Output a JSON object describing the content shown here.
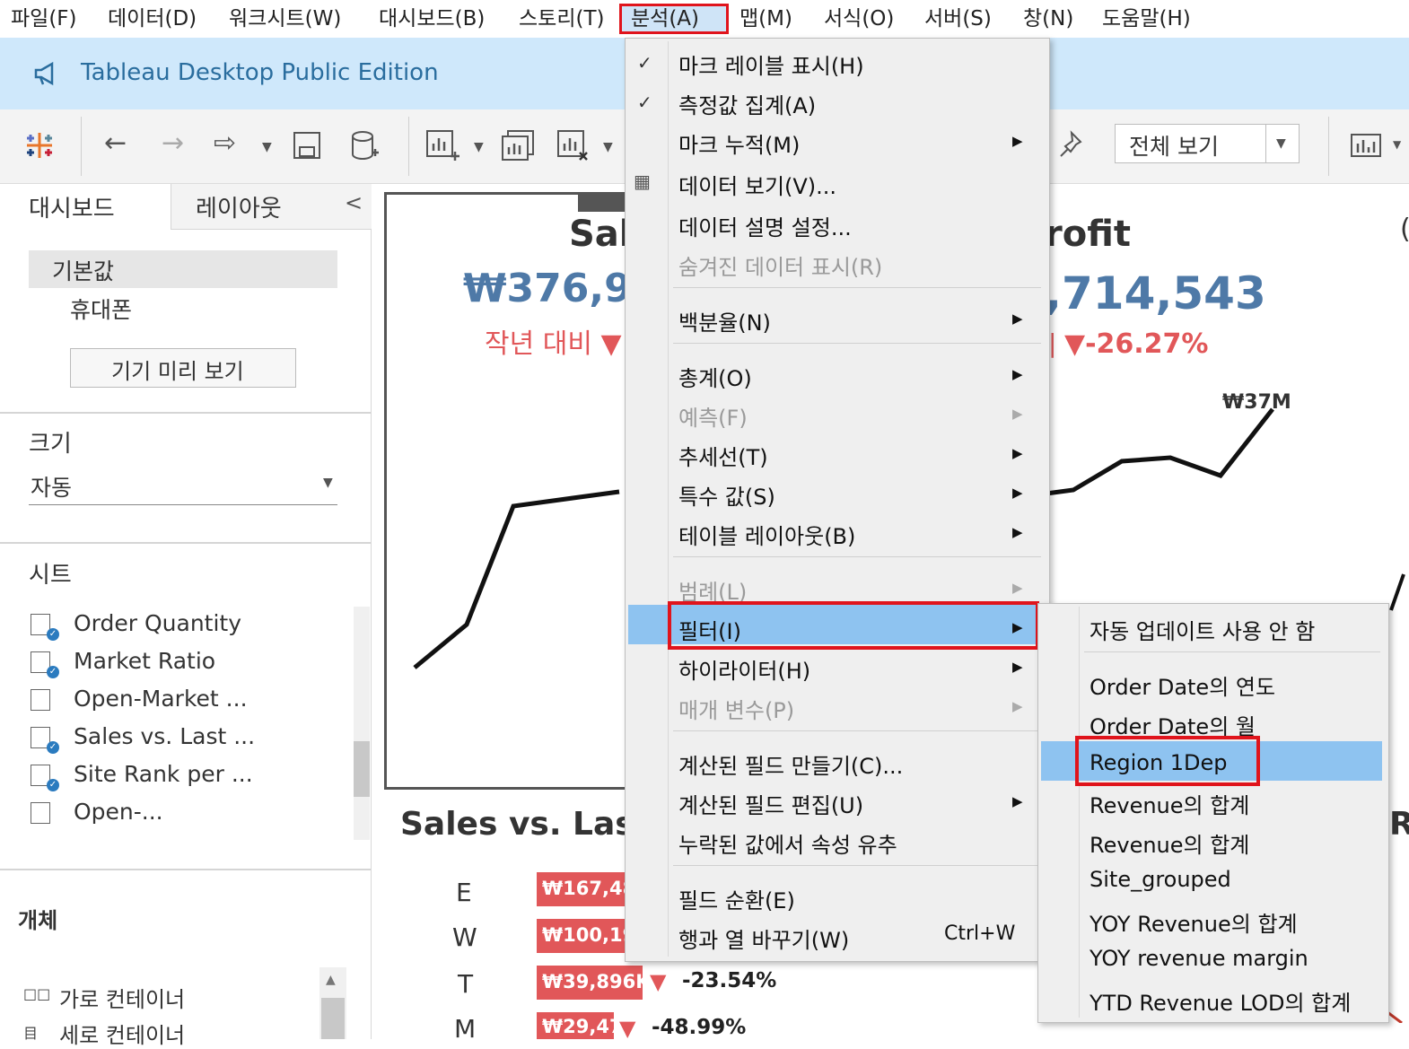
{
  "menubar": {
    "items": [
      "파일(F)",
      "데이터(D)",
      "워크시트(W)",
      "대시보드(B)",
      "스토리(T)",
      "분석(A)",
      "맵(M)",
      "서식(O)",
      "서버(S)",
      "창(N)",
      "도움말(H)"
    ]
  },
  "app": {
    "title": "Tableau Desktop Public Edition"
  },
  "toolbar": {
    "fit_select": "전체 보기"
  },
  "left_panel": {
    "tab_dashboard": "대시보드",
    "tab_layout": "레이아웃",
    "collapse": "<",
    "device_default": "기본값",
    "device_phone": "휴대폰",
    "device_preview_button": "기기 미리 보기",
    "size_header": "크기",
    "size_value": "자동",
    "sheets_header": "시트",
    "sheets": [
      "Order Quantity",
      "Market Ratio",
      "Open-Market ...",
      "Sales vs. Last ...",
      "Site Rank per ...",
      "Open-..."
    ],
    "objects_header": "개체",
    "objects": [
      "가로 컨테이너",
      "세로 컨테이너"
    ]
  },
  "dashboard": {
    "sales_title": "Sal",
    "sales_value": "₩376,9",
    "sales_yoy_label": "작년 대비 ▼",
    "profit_title": "rofit",
    "profit_value": ",714,543",
    "profit_yoy": "▼-26.27%",
    "profit_yoy_prefix": "|",
    "profit_peak_label": "₩37M",
    "bottom_title": "Sales vs. Last",
    "bottom_right_letter": "R",
    "right_edge_char": "(",
    "bars": [
      {
        "label": "E",
        "value": "₩167,48",
        "pct": ""
      },
      {
        "label": "W",
        "value": "₩100,19",
        "pct": ""
      },
      {
        "label": "T",
        "value": "₩39,896K",
        "pct": "-23.54%"
      },
      {
        "label": "M",
        "value": "₩29,47",
        "pct": "-48.99%"
      }
    ]
  },
  "analysis_menu": {
    "items": [
      {
        "label": "마크 레이블 표시(H)",
        "checked": true
      },
      {
        "label": "측정값 집계(A)",
        "checked": true
      },
      {
        "label": "마크 누적(M)",
        "submenu": true
      },
      {
        "label": "데이터 보기(V)...",
        "icon": "table"
      },
      {
        "label": "데이터 설명 설정..."
      },
      {
        "label": "숨겨진 데이터 표시(R)",
        "disabled": true
      },
      {
        "label": "백분율(N)",
        "submenu": true
      },
      {
        "label": "총계(O)",
        "submenu": true
      },
      {
        "label": "예측(F)",
        "submenu": true,
        "disabled": true
      },
      {
        "label": "추세선(T)",
        "submenu": true
      },
      {
        "label": "특수 값(S)",
        "submenu": true
      },
      {
        "label": "테이블 레이아웃(B)",
        "submenu": true
      },
      {
        "label": "범례(L)",
        "submenu": true,
        "disabled": true
      },
      {
        "label": "필터(I)",
        "submenu": true,
        "highlighted": true
      },
      {
        "label": "하이라이터(H)",
        "submenu": true
      },
      {
        "label": "매개 변수(P)",
        "submenu": true,
        "disabled": true
      },
      {
        "label": "계산된 필드 만들기(C)..."
      },
      {
        "label": "계산된 필드 편집(U)",
        "submenu": true
      },
      {
        "label": "누락된 값에서 속성 유추"
      },
      {
        "label": "필드 순환(E)"
      },
      {
        "label": "행과 열 바꾸기(W)",
        "shortcut": "Ctrl+W"
      }
    ]
  },
  "filter_submenu": {
    "items": [
      {
        "label": "자동 업데이트 사용 안 함"
      },
      {
        "label": "Order Date의 연도"
      },
      {
        "label": "Order Date의 월"
      },
      {
        "label": "Region 1Dep",
        "highlighted": true
      },
      {
        "label": "Revenue의 합계"
      },
      {
        "label": "Revenue의 합계"
      },
      {
        "label": "Site_grouped"
      },
      {
        "label": "YOY Revenue의 합계"
      },
      {
        "label": "YOY revenue margin"
      },
      {
        "label": "YTD Revenue LOD의 합계"
      }
    ]
  },
  "colors": {
    "accent_blue": "#4e79a7",
    "negative_red": "#e15759",
    "highlight_box": "#e0141c",
    "menu_highlight": "#8ec3f0"
  }
}
